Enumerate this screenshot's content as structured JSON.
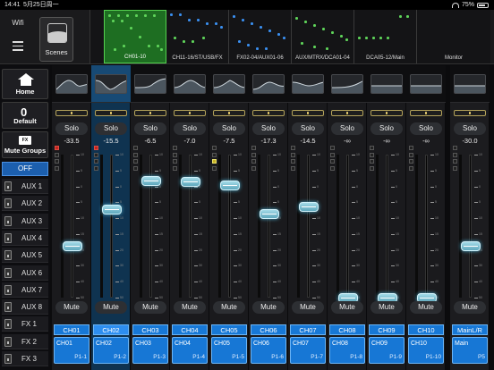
{
  "status": {
    "time": "14:41",
    "date": "5月25日周一",
    "battery": "75%"
  },
  "topbar": {
    "wifi_label": "Wifi",
    "scenes_label": "Scenes"
  },
  "overview": {
    "segments": [
      {
        "label": "CH01-10",
        "active": true
      },
      {
        "label": "CH11-16/ST/USB/FX",
        "active": false
      },
      {
        "label": "FX02-04/AUX01-06",
        "active": false
      },
      {
        "label": "AUX/MTRX/DCA01-04",
        "active": false
      },
      {
        "label": "DCA05-12/Main",
        "active": false
      },
      {
        "label": "Monitor",
        "active": false
      }
    ]
  },
  "sidebar": {
    "home_label": "Home",
    "default_label": "Default",
    "default_glyph": "0",
    "mute_groups_label": "Mute Groups",
    "mute_groups_icon_text": "FX",
    "off_label": "OFF",
    "items": [
      "AUX 1",
      "AUX 2",
      "AUX 3",
      "AUX 4",
      "AUX 5",
      "AUX 6",
      "AUX 7",
      "AUX 8",
      "FX 1",
      "FX 2",
      "FX 3"
    ]
  },
  "strips": [
    {
      "id": "CH01",
      "name": "CH01",
      "patch": "P1-1",
      "solo": "Solo",
      "level_db": "-33.5",
      "fader": 0.36,
      "mute": "Mute",
      "selected": false
    },
    {
      "id": "CH02",
      "name": "CH02",
      "patch": "P1-2",
      "solo": "Solo",
      "level_db": "-15.5",
      "fader": 0.62,
      "mute": "Mute",
      "selected": true
    },
    {
      "id": "CH03",
      "name": "CH03",
      "patch": "P1-3",
      "solo": "Solo",
      "level_db": "-6.5",
      "fader": 0.82,
      "mute": "Mute",
      "selected": false
    },
    {
      "id": "CH04",
      "name": "CH04",
      "patch": "P1-4",
      "solo": "Solo",
      "level_db": "-7.0",
      "fader": 0.81,
      "mute": "Mute",
      "selected": false
    },
    {
      "id": "CH05",
      "name": "CH05",
      "patch": "P1-5",
      "solo": "Solo",
      "level_db": "-7.5",
      "fader": 0.79,
      "mute": "Mute",
      "selected": false
    },
    {
      "id": "CH06",
      "name": "CH06",
      "patch": "P1-6",
      "solo": "Solo",
      "level_db": "-17.3",
      "fader": 0.59,
      "mute": "Mute",
      "selected": false
    },
    {
      "id": "CH07",
      "name": "CH07",
      "patch": "P1-7",
      "solo": "Solo",
      "level_db": "-14.5",
      "fader": 0.64,
      "mute": "Mute",
      "selected": false
    },
    {
      "id": "CH08",
      "name": "CH08",
      "patch": "P1-8",
      "solo": "Solo",
      "level_db": "-∞",
      "fader": 0.0,
      "mute": "Mute",
      "selected": false
    },
    {
      "id": "CH09",
      "name": "CH09",
      "patch": "P1-9",
      "solo": "Solo",
      "level_db": "-∞",
      "fader": 0.0,
      "mute": "Mute",
      "selected": false
    },
    {
      "id": "CH10",
      "name": "CH10",
      "patch": "P1-10",
      "solo": "Solo",
      "level_db": "-∞",
      "fader": 0.0,
      "mute": "Mute",
      "selected": false
    },
    {
      "id": "MainLR",
      "name": "MainL/R",
      "patch": "P5",
      "name_box": "Main",
      "solo": "Solo",
      "level_db": "-30.0",
      "fader": 0.36,
      "mute": "Mute",
      "selected": false
    }
  ],
  "scale_labels": [
    "10",
    "5",
    "0",
    "5",
    "10",
    "15",
    "20",
    "30",
    "40",
    "50"
  ],
  "colors": {
    "accent_blue": "#1778d6",
    "active_green": "#1e6e22",
    "fader_cyan": "#7cc4d6"
  }
}
